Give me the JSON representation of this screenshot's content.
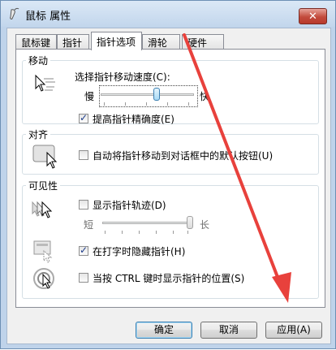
{
  "window": {
    "title": "鼠标 属性",
    "close_label": "✕"
  },
  "tabs": [
    {
      "label": "鼠标键",
      "active": false
    },
    {
      "label": "指针",
      "active": false
    },
    {
      "label": "指针选项",
      "active": true
    },
    {
      "label": "滑轮",
      "active": false
    },
    {
      "label": "硬件",
      "active": false
    }
  ],
  "motion": {
    "group_title": "移动",
    "speed_label": "选择指针移动速度(C):",
    "slow_label": "慢",
    "fast_label": "快",
    "speed_level": 0.6,
    "precision_label": "提高指针精确度(E)",
    "precision_checked": true
  },
  "snap": {
    "group_title": "对齐",
    "snap_label": "自动将指针移动到对话框中的默认按钮(U)",
    "snap_checked": false
  },
  "visibility": {
    "group_title": "可见性",
    "trails_label": "显示指针轨迹(D)",
    "trails_checked": false,
    "short_label": "短",
    "long_label": "长",
    "trails_level": 1.0,
    "hide_label": "在打字时隐藏指针(H)",
    "hide_checked": true,
    "ctrl_label": "当按 CTRL 键时显示指针的位置(S)",
    "ctrl_checked": false
  },
  "buttons": {
    "ok": "确定",
    "cancel": "取消",
    "apply": "应用(A)"
  },
  "colors": {
    "annotation_arrow": "#e8413c"
  }
}
